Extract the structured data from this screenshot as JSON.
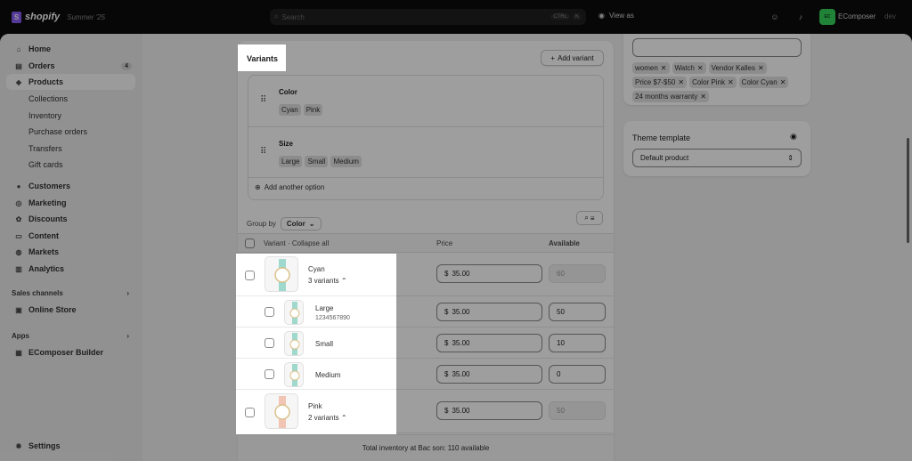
{
  "topbar": {
    "brand": "shopify",
    "edition": "Summer '25",
    "search_placeholder": "Search",
    "kbd1": "CTRL",
    "kbd2": "K",
    "view_as": "View as",
    "store_badge": "EC",
    "store_name": "EComposer",
    "store_tag": "dev"
  },
  "sidebar": {
    "items": [
      {
        "label": "Home",
        "icon": "⌂"
      },
      {
        "label": "Orders",
        "icon": "▤",
        "count": "4"
      },
      {
        "label": "Products",
        "icon": "◈"
      },
      {
        "label": "Collections"
      },
      {
        "label": "Inventory"
      },
      {
        "label": "Purchase orders"
      },
      {
        "label": "Transfers"
      },
      {
        "label": "Gift cards"
      },
      {
        "label": "Customers",
        "icon": "●"
      },
      {
        "label": "Marketing",
        "icon": "◎"
      },
      {
        "label": "Discounts",
        "icon": "✿"
      },
      {
        "label": "Content",
        "icon": "▭"
      },
      {
        "label": "Markets",
        "icon": "◍"
      },
      {
        "label": "Analytics",
        "icon": "▥"
      },
      {
        "label": "Online Store",
        "icon": "▣"
      },
      {
        "label": "EComposer Builder",
        "icon": "▦"
      },
      {
        "label": "Settings",
        "icon": "✹"
      }
    ],
    "sales_channels": "Sales channels",
    "apps": "Apps"
  },
  "variants": {
    "title": "Variants",
    "add_variant": "Add variant",
    "options": [
      {
        "name": "Color",
        "values": [
          "Cyan",
          "Pink"
        ]
      },
      {
        "name": "Size",
        "values": [
          "Large",
          "Small",
          "Medium"
        ]
      }
    ],
    "add_option": "Add another option",
    "group_by_label": "Group by",
    "group_by_value": "Color",
    "columns": {
      "variant": "Variant · Collapse all",
      "price": "Price",
      "available": "Available"
    },
    "rows": [
      {
        "name": "Cyan",
        "sub": "3 variants",
        "currency": "$",
        "price": "35.00",
        "available": "60"
      },
      {
        "name": "Large",
        "sub": "1234567890",
        "currency": "$",
        "price": "35.00",
        "available": "50"
      },
      {
        "name": "Small",
        "currency": "$",
        "price": "35.00",
        "available": "10"
      },
      {
        "name": "Medium",
        "currency": "$",
        "price": "35.00",
        "available": "0"
      },
      {
        "name": "Pink",
        "sub": "2 variants",
        "currency": "$",
        "price": "35.00",
        "available": "50"
      }
    ],
    "total": "Total inventory at Bac son: 110 available"
  },
  "tags": [
    "women",
    "Watch",
    "Vendor Kalles",
    "Price $7-$50",
    "Color Pink",
    "Color Cyan",
    "24 months warranty"
  ],
  "theme": {
    "title": "Theme template",
    "value": "Default product"
  },
  "colors": {
    "topbar": "#0c0c0c",
    "accent": "#8a5cf6",
    "store_badge": "#36d35a"
  }
}
